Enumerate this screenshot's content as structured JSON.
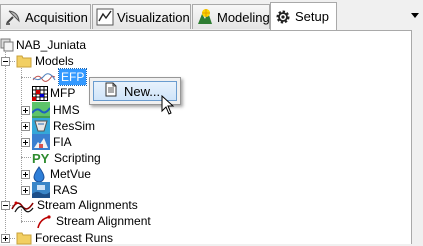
{
  "tabs": [
    {
      "label": "Acquisition",
      "icon": "satellite-dish-icon",
      "active": false
    },
    {
      "label": "Visualization",
      "icon": "chart-icon",
      "active": false
    },
    {
      "label": "Modeling",
      "icon": "modeling-icon",
      "active": false
    },
    {
      "label": "Setup",
      "icon": "gear-icon",
      "active": true
    }
  ],
  "tree": {
    "root": "NAB_Juniata",
    "models": "Models",
    "model_items": [
      "EFP",
      "MFP",
      "HMS",
      "ResSim",
      "FIA",
      "Scripting",
      "MetVue",
      "RAS"
    ],
    "stream_alignments": "Stream Alignments",
    "stream_alignment_item": "Stream Alignment",
    "forecast_runs": "Forecast Runs"
  },
  "context_menu": {
    "new_label": "New..."
  },
  "colors": {
    "selection": "#3399ff",
    "folder": "#f2cf62"
  }
}
